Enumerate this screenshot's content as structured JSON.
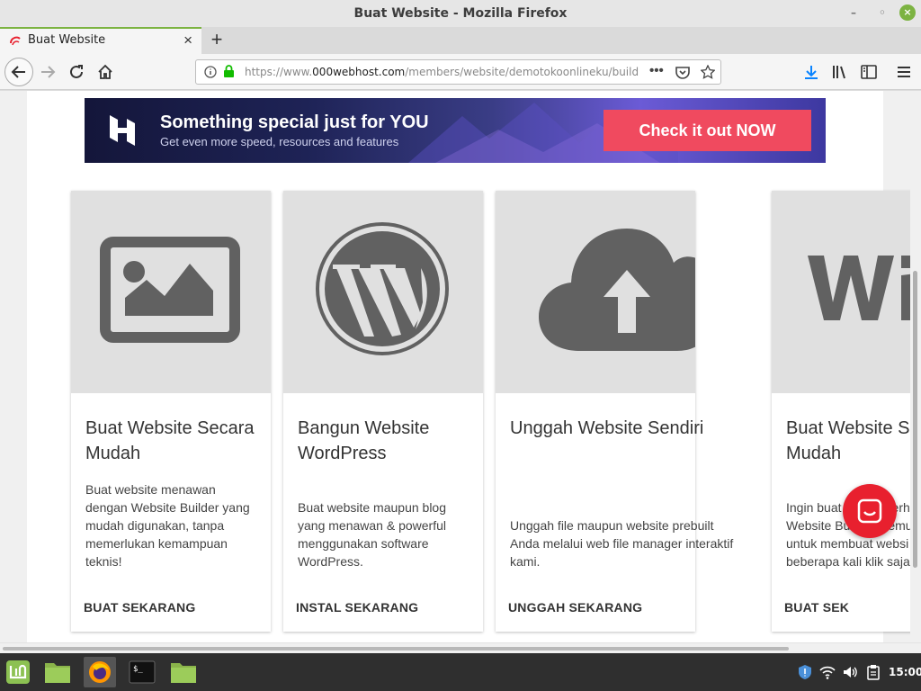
{
  "window": {
    "title": "Buat Website - Mozilla Firefox"
  },
  "tab": {
    "title": "Buat Website"
  },
  "url": {
    "prefix": "https://www.",
    "domain": "000webhost.com",
    "path": "/members/website/demotokoonlineku/build"
  },
  "banner": {
    "title": "Something special just for YOU",
    "subtitle": "Get even more speed, resources and features",
    "button": "Check it out NOW"
  },
  "cards": [
    {
      "title1": "Buat Website Secara",
      "title2": "Mudah",
      "desc": [
        "Buat website menawan",
        "dengan Website Builder yang",
        "mudah digunakan, tanpa",
        "memerlukan kemampuan",
        "teknis!"
      ],
      "action": "BUAT SEKARANG",
      "icon": "image-icon"
    },
    {
      "title1": "Bangun Website",
      "title2": "WordPress",
      "desc": [
        "Buat website maupun blog",
        "yang menawan & powerful",
        "menggunakan software",
        "WordPress."
      ],
      "action": "INSTAL SEKARANG",
      "icon": "wordpress-icon"
    },
    {
      "title1": "Unggah Website Sendiri",
      "title2": "",
      "desc": [
        "Unggah file maupun website prebuilt",
        "Anda melalui web file manager interaktif",
        "kami."
      ],
      "action": "UNGGAH SEKARANG",
      "icon": "cloud-upload-icon"
    },
    {
      "title1": "Buat Website Se",
      "title2": "Mudah",
      "desc": [
        "Ingin buat web sederh",
        "Website Builder memu",
        "untuk membuat websi",
        "beberapa kali klik saja."
      ],
      "action": "BUAT SEK",
      "icon": "wix-icon"
    }
  ],
  "taskbar": {
    "clock": "15:00"
  },
  "colors": {
    "accent": "#7cb342",
    "banner_button": "#f04a5f",
    "chat": "#e8202e",
    "icon_gray": "#616161"
  }
}
